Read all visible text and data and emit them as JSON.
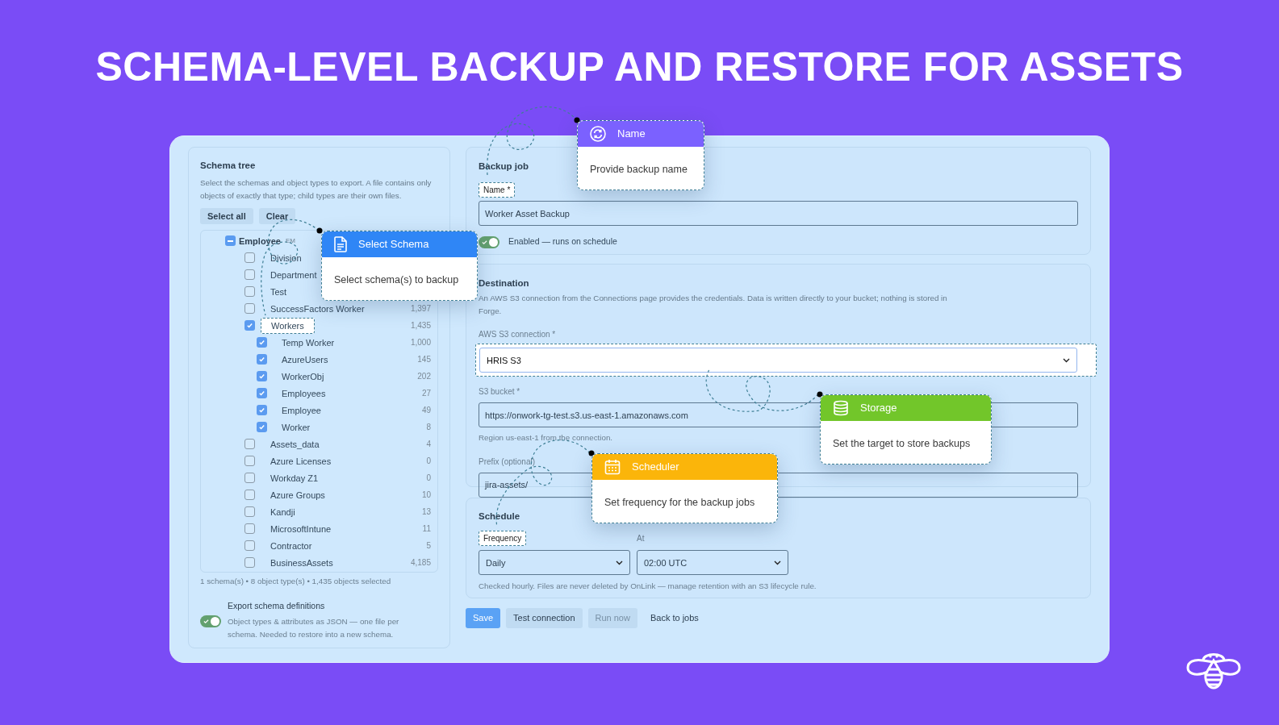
{
  "headline": "SCHEMA-LEVEL BACKUP AND RESTORE FOR ASSETS",
  "schema_tree": {
    "title": "Schema tree",
    "description": "Select the schemas and object types to export. A file contains only objects of exactly that type; child types are their own files.",
    "buttons": [
      "Select all",
      "Clear"
    ],
    "items": [
      {
        "label": "Employee",
        "tag": "EM",
        "indeterminate": true,
        "highlighted": false,
        "children": [
          {
            "label": "Division",
            "checked": false,
            "highlighted": false
          },
          {
            "label": "Department",
            "checked": false,
            "highlighted": false
          },
          {
            "label": "Test",
            "checked": false,
            "highlighted": false
          },
          {
            "label": "SuccessFactors Worker",
            "count": "1,397",
            "checked": false,
            "highlighted": false
          },
          {
            "label": "Workers",
            "count": "1,435",
            "checked": true,
            "highlighted": true,
            "children": [
              {
                "label": "Temp Worker",
                "count": "1,000",
                "checked": true,
                "highlighted": false
              },
              {
                "label": "AzureUsers",
                "count": "145",
                "checked": true,
                "highlighted": false
              },
              {
                "label": "WorkerObj",
                "count": "202",
                "checked": true,
                "highlighted": false
              },
              {
                "label": "Employees",
                "count": "27",
                "checked": true,
                "highlighted": false
              },
              {
                "label": "Employee",
                "count": "49",
                "checked": true,
                "highlighted": false
              },
              {
                "label": "Worker",
                "count": "8",
                "checked": true,
                "highlighted": false
              }
            ]
          },
          {
            "label": "Assets_data",
            "count": "4",
            "checked": false,
            "highlighted": false
          },
          {
            "label": "Azure Licenses",
            "count": "0",
            "checked": false,
            "highlighted": false
          },
          {
            "label": "Workday Z1",
            "count": "0",
            "checked": false,
            "highlighted": false
          },
          {
            "label": "Azure Groups",
            "count": "10",
            "checked": false,
            "highlighted": false
          },
          {
            "label": "Kandji",
            "count": "13",
            "checked": false,
            "highlighted": false
          },
          {
            "label": "MicrosoftIntune",
            "count": "11",
            "checked": false,
            "highlighted": false
          },
          {
            "label": "Contractor",
            "count": "5",
            "checked": false,
            "highlighted": false
          },
          {
            "label": "BusinessAssets",
            "count": "4,185",
            "checked": false,
            "highlighted": false
          }
        ]
      }
    ],
    "summary": "1 schema(s) • 8 object type(s) • 1,435 objects selected",
    "export": {
      "title": "Export schema definitions",
      "description": "Object types & attributes as JSON — one file per schema. Needed to restore into a new schema.",
      "on": true
    }
  },
  "backup_job": {
    "title": "Backup job",
    "name_field": {
      "label": "Name *",
      "highlighted": true,
      "value": "Worker Asset Backup"
    },
    "enabled": {
      "label": "Enabled — runs on schedule",
      "on": true
    }
  },
  "destination": {
    "title": "Destination",
    "description": "An AWS S3 connection from the Connections page provides the credentials. Data is written directly to your bucket; nothing is stored in Forge.",
    "connection": {
      "label": "AWS S3 connection *",
      "value": "HRIS S3",
      "highlighted": true
    },
    "bucket": {
      "label": "S3 bucket *",
      "value": "https://onwork-tg-test.s3.us-east-1.amazonaws.com",
      "hint": "Region us-east-1 from the connection."
    },
    "prefix": {
      "label": "Prefix (optional)",
      "value": "jira-assets/"
    }
  },
  "schedule": {
    "title": "Schedule",
    "frequency": {
      "label": "Frequency",
      "highlighted": true,
      "value": "Daily"
    },
    "at": {
      "label": "At",
      "highlighted": false,
      "value": "02:00 UTC"
    },
    "note": "Checked hourly. Files are never deleted by OnLink — manage retention with an S3 lifecycle rule."
  },
  "actions": [
    {
      "label": "Save",
      "kind": "primary",
      "disabled": false
    },
    {
      "label": "Test connection",
      "kind": "secondary",
      "disabled": false
    },
    {
      "label": "Run now",
      "kind": "secondary",
      "disabled": true
    },
    {
      "label": "Back to jobs",
      "kind": "link",
      "disabled": false
    }
  ],
  "callouts": [
    {
      "title": "Name",
      "text": "Provide backup name",
      "color": "#7b61ff"
    },
    {
      "title": "Select Schema",
      "text": "Select schema(s) to backup",
      "color": "#2f86f6"
    },
    {
      "title": "Storage",
      "text": "Set the target to store backups",
      "color": "#72c62a"
    },
    {
      "title": "Scheduler",
      "text": "Set frequency for the backup jobs",
      "color": "#fbb50a"
    }
  ]
}
